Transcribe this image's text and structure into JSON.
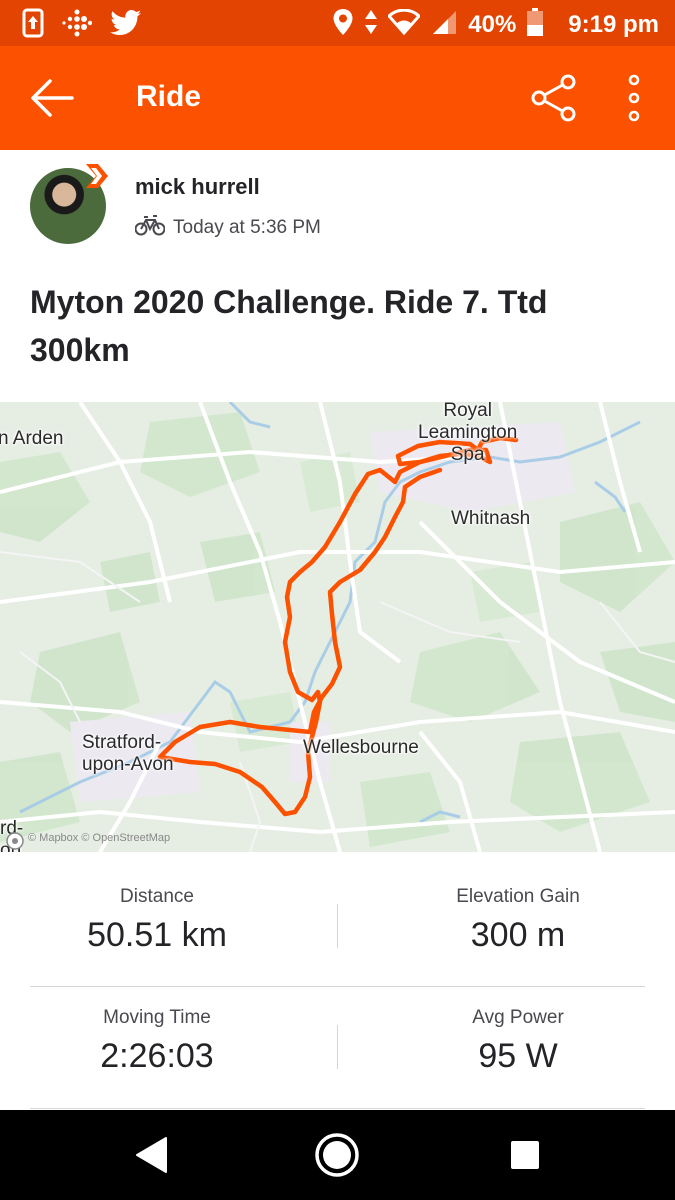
{
  "status_bar": {
    "battery_percent": "40%",
    "time": "9:19 pm",
    "left_icons": [
      "phone-update-icon",
      "fitbit-icon",
      "twitter-icon"
    ],
    "right_icons": [
      "location-icon",
      "data-arrows-icon",
      "wifi-icon",
      "signal-icon",
      "battery-icon"
    ]
  },
  "app_bar": {
    "title": "Ride",
    "icons": [
      "back-arrow-icon",
      "share-icon",
      "more-vertical-icon"
    ]
  },
  "activity": {
    "athlete_name": "mick hurrell",
    "timestamp": "Today at 5:36 PM",
    "sport_icon": "bike-icon",
    "title": "Myton 2020 Challenge. Ride 7. Ttd 300km"
  },
  "map": {
    "labels": {
      "arden": "n Arden",
      "royal_leamington": "Royal\nLeamington\nSpa",
      "whitnash": "Whitnash",
      "stratford": "Stratford-\nupon-Avon",
      "wellesbourne": "Wellesbourne",
      "partial_left": "rd-\non"
    },
    "attribution": "© Mapbox © OpenStreetMap",
    "route_color": "#fc5200"
  },
  "stats": {
    "distance": {
      "label": "Distance",
      "value": "50.51 km"
    },
    "elevation": {
      "label": "Elevation Gain",
      "value": "300 m"
    },
    "moving_time": {
      "label": "Moving Time",
      "value": "2:26:03"
    },
    "avg_power": {
      "label": "Avg Power",
      "value": "95 W"
    }
  },
  "nav_bar": {
    "icons": [
      "back-triangle-icon",
      "home-circle-icon",
      "recents-square-icon"
    ]
  },
  "colors": {
    "brand": "#fc5200",
    "status_bar": "#e34402"
  }
}
